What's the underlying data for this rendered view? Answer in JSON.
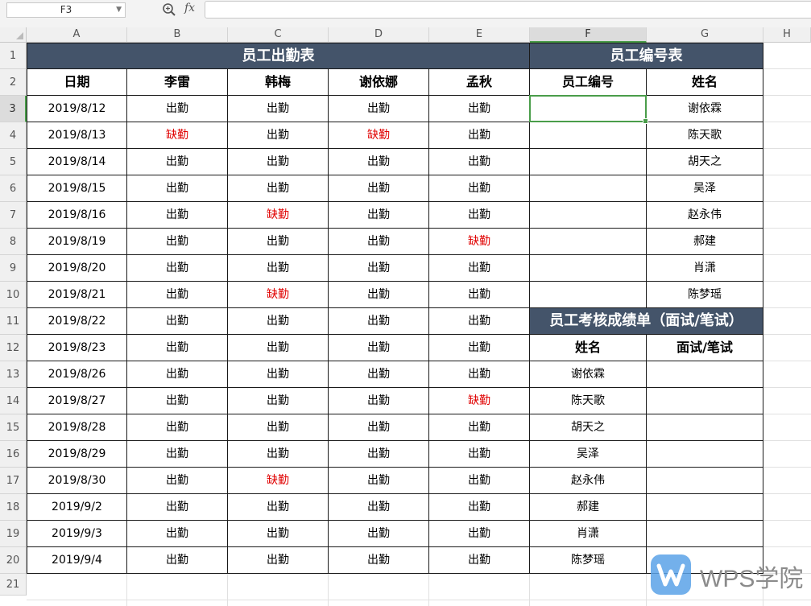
{
  "formula_bar": {
    "name_box": "F3",
    "fx_label": "fx",
    "formula": ""
  },
  "columns": [
    "A",
    "B",
    "C",
    "D",
    "E",
    "F",
    "G",
    "H"
  ],
  "rows": [
    "1",
    "2",
    "3",
    "4",
    "5",
    "6",
    "7",
    "8",
    "9",
    "10",
    "11",
    "12",
    "13",
    "14",
    "15",
    "16",
    "17",
    "18",
    "19",
    "20",
    "21"
  ],
  "attendance": {
    "title": "员工出勤表",
    "headers": [
      "日期",
      "李雷",
      "韩梅",
      "谢依娜",
      "孟秋"
    ],
    "records": [
      [
        "2019/8/12",
        "出勤",
        "出勤",
        "出勤",
        "出勤"
      ],
      [
        "2019/8/13",
        "缺勤",
        "出勤",
        "缺勤",
        "出勤"
      ],
      [
        "2019/8/14",
        "出勤",
        "出勤",
        "出勤",
        "出勤"
      ],
      [
        "2019/8/15",
        "出勤",
        "出勤",
        "出勤",
        "出勤"
      ],
      [
        "2019/8/16",
        "出勤",
        "缺勤",
        "出勤",
        "出勤"
      ],
      [
        "2019/8/19",
        "出勤",
        "出勤",
        "出勤",
        "缺勤"
      ],
      [
        "2019/8/20",
        "出勤",
        "出勤",
        "出勤",
        "出勤"
      ],
      [
        "2019/8/21",
        "出勤",
        "缺勤",
        "出勤",
        "出勤"
      ],
      [
        "2019/8/22",
        "出勤",
        "出勤",
        "出勤",
        "出勤"
      ],
      [
        "2019/8/23",
        "出勤",
        "出勤",
        "出勤",
        "出勤"
      ],
      [
        "2019/8/26",
        "出勤",
        "出勤",
        "出勤",
        "出勤"
      ],
      [
        "2019/8/27",
        "出勤",
        "出勤",
        "出勤",
        "缺勤"
      ],
      [
        "2019/8/28",
        "出勤",
        "出勤",
        "出勤",
        "出勤"
      ],
      [
        "2019/8/29",
        "出勤",
        "出勤",
        "出勤",
        "出勤"
      ],
      [
        "2019/8/30",
        "出勤",
        "缺勤",
        "出勤",
        "出勤"
      ],
      [
        "2019/9/2",
        "出勤",
        "出勤",
        "出勤",
        "出勤"
      ],
      [
        "2019/9/3",
        "出勤",
        "出勤",
        "出勤",
        "出勤"
      ],
      [
        "2019/9/4",
        "出勤",
        "出勤",
        "出勤",
        "出勤"
      ]
    ]
  },
  "employee_ids": {
    "title": "员工编号表",
    "headers": [
      "员工编号",
      "姓名"
    ],
    "records": [
      [
        "",
        "谢依霖"
      ],
      [
        "",
        "陈天歌"
      ],
      [
        "",
        "胡天之"
      ],
      [
        "",
        "吴泽"
      ],
      [
        "",
        "赵永伟"
      ],
      [
        "",
        "郝建"
      ],
      [
        "",
        "肖潇"
      ],
      [
        "",
        "陈梦瑶"
      ]
    ]
  },
  "scores": {
    "title": "员工考核成绩单（面试/笔试）",
    "headers": [
      "姓名",
      "面试/笔试"
    ],
    "records": [
      [
        "谢依霖",
        ""
      ],
      [
        "陈天歌",
        ""
      ],
      [
        "胡天之",
        ""
      ],
      [
        "吴泽",
        ""
      ],
      [
        "赵永伟",
        ""
      ],
      [
        "郝建",
        ""
      ],
      [
        "肖潇",
        ""
      ],
      [
        "陈梦瑶",
        ""
      ]
    ]
  },
  "absent_value": "缺勤",
  "colors": {
    "title_bg": "#44546a",
    "absent": "#e00000",
    "selection": "#4a9d4a"
  },
  "watermark": {
    "text": "WPS学院"
  }
}
